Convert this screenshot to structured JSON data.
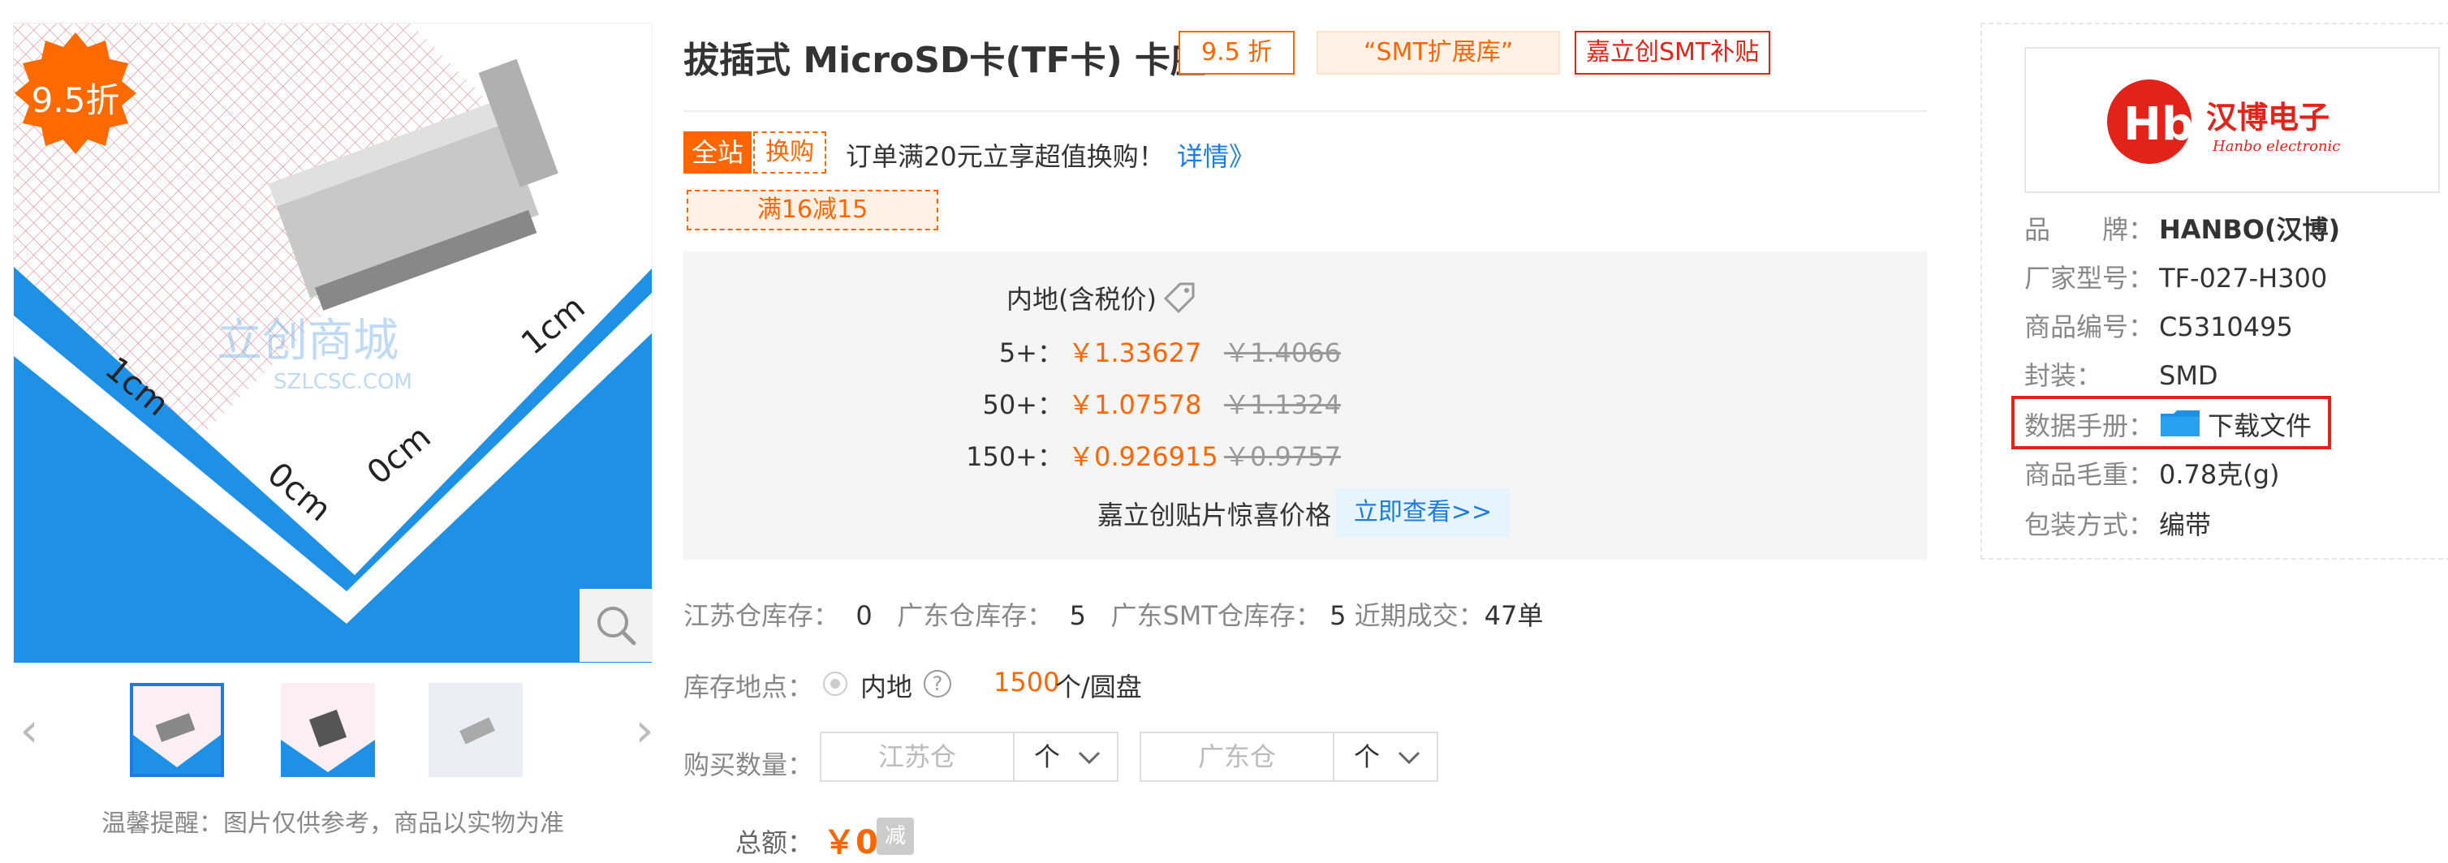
{
  "gallery": {
    "discount_badge": "9.5折",
    "watermark": "立创商城",
    "watermark_url": "SZLCSC.COM",
    "ruler_labels": [
      "1cm",
      "1cm",
      "0cm",
      "0cm"
    ],
    "note": "温馨提醒：图片仅供参考，商品以实物为准",
    "prev_arrow": "‹",
    "next_arrow": "›",
    "zoom_icon": "search-icon",
    "thumbnail_count": 3,
    "active_thumbnail": 1
  },
  "product": {
    "title": "拔插式 MicroSD卡(TF卡) 卡座",
    "tags": {
      "discount": "9.5 折",
      "smt": "“SMT扩展库”",
      "subsidy": "嘉立创SMT补贴"
    }
  },
  "promo": {
    "site_wide": "全站",
    "swap": "换购",
    "text": "订单满20元立享超值换购！",
    "link": "详情》",
    "coupon": "满16减15"
  },
  "pricing": {
    "header": "内地(含税价)",
    "tiers": [
      {
        "qty": "5+：",
        "price": "￥1.33627",
        "old": "￥1.4066"
      },
      {
        "qty": "50+：",
        "price": "￥1.07578",
        "old": "￥1.1324"
      },
      {
        "qty": "150+：",
        "price": "￥0.926915",
        "old": "￥0.9757"
      }
    ],
    "sticker_text": "嘉立创贴片惊喜价格",
    "sticker_button": "立即查看>>"
  },
  "stock": {
    "jiangsu_label": "江苏仓库存：",
    "jiangsu_value": "0",
    "guangdong_label": "广东仓库存：",
    "guangdong_value": "5",
    "smt_label": "广东SMT仓库存：",
    "smt_value": "5",
    "recent_label": "近期成交：",
    "recent_value": "47单",
    "location_label": "库存地点：",
    "location_value": "内地",
    "help": "?",
    "reel_qty": "1500",
    "reel_unit": "个/圆盘"
  },
  "purchase": {
    "label": "购买数量：",
    "jiangsu_placeholder": "江苏仓",
    "guangdong_placeholder": "广东仓",
    "unit": "个",
    "total_label": "总额：",
    "total_value": "￥0",
    "reduce": "减"
  },
  "brand": {
    "logo_text": "汉博电子",
    "logo_sub": "Hanbo electronic",
    "specs": [
      {
        "key": "品　　牌：",
        "value": "HANBO(汉博)"
      },
      {
        "key": "厂家型号：",
        "value": "TF-027-H300"
      },
      {
        "key": "商品编号：",
        "value": "C5310495"
      },
      {
        "key": "封装：",
        "value": "SMD"
      },
      {
        "key": "数据手册：",
        "value": ""
      },
      {
        "key": "商品毛重：",
        "value": "0.78克(g)"
      },
      {
        "key": "包装方式：",
        "value": "编带"
      }
    ],
    "download": "下载文件",
    "download_icon": "folder-icon"
  },
  "colors": {
    "accent": "#ff6600",
    "link": "#1e7be0",
    "highlight": "#e2231a"
  }
}
